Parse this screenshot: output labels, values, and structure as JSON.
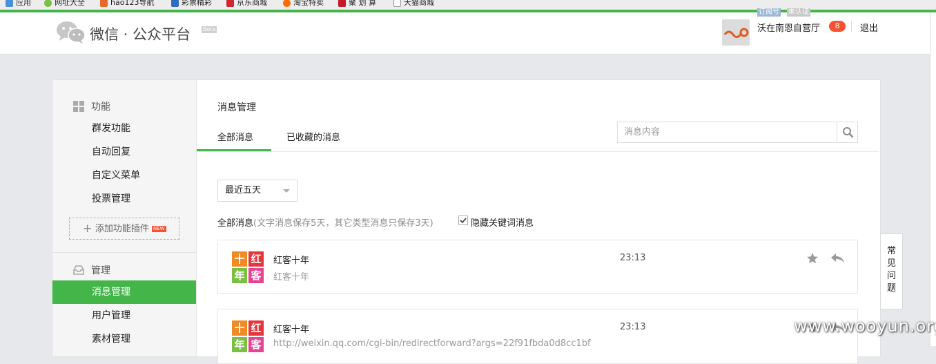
{
  "browser": {
    "bookmarks": [
      {
        "label": "应用",
        "icon": "apps-icon",
        "color": "#4a90d9"
      },
      {
        "label": "网址大全",
        "icon": "web-directory-icon",
        "color": "#7ac043"
      },
      {
        "label": "hao123导航",
        "icon": "hao123-icon",
        "color": "#e9672a"
      },
      {
        "label": "彩票精彩",
        "icon": "lottery-icon",
        "color": "#2f6dc2"
      },
      {
        "label": "京东商城",
        "icon": "jd-icon",
        "color": "#d0242f"
      },
      {
        "label": "淘宝特卖",
        "icon": "taobao-icon",
        "color": "#ff6a00"
      },
      {
        "label": "聚 划 算",
        "icon": "juhuasuan-icon",
        "color": "#c6172b"
      },
      {
        "label": "天猫商城",
        "icon": "tmall-icon",
        "color": "#ffffff"
      }
    ]
  },
  "header": {
    "logo_text": "微信 · 公众平台",
    "beta_label": "Beta",
    "account": {
      "tag_type": "订阅号",
      "tag_verify": "未认证",
      "name": "沃在南恩自营厅",
      "notification_count": "8",
      "logout_label": "退出"
    }
  },
  "sidebar": {
    "sections": [
      {
        "title": "功能",
        "icon": "grid-icon",
        "items": [
          {
            "label": "群发功能"
          },
          {
            "label": "自动回复"
          },
          {
            "label": "自定义菜单"
          },
          {
            "label": "投票管理"
          }
        ]
      },
      {
        "title": "管理",
        "icon": "inbox-icon",
        "items": [
          {
            "label": "消息管理",
            "active": true
          },
          {
            "label": "用户管理"
          },
          {
            "label": "素材管理"
          }
        ]
      }
    ],
    "add_plugin_label": "添加功能插件",
    "add_plugin_plus": "+",
    "new_badge": "NEW"
  },
  "main": {
    "title": "消息管理",
    "tabs": [
      {
        "label": "全部消息",
        "active": true
      },
      {
        "label": "已收藏的消息"
      }
    ],
    "search": {
      "placeholder": "消息内容",
      "value": ""
    },
    "filter": {
      "selected": "最近五天"
    },
    "summary": {
      "label": "全部消息",
      "note": "(文字消息保存5天，其它类型消息只保存3天)"
    },
    "hide_keyword": {
      "label": "隐藏关键词消息",
      "checked": true
    },
    "messages": [
      {
        "sender": "红客十年",
        "content": "红客十年",
        "time": "23:13"
      },
      {
        "sender": "红客十年",
        "content": "http://weixin.qq.com/cgi-bin/redirectforward?args=22f91fbda0d8cc1bf",
        "time": "23:13"
      }
    ],
    "avatar_glyphs": [
      "十",
      "红",
      "年",
      "客"
    ],
    "avatar_colors": [
      "#f08a24",
      "#e5363a",
      "#7ac143",
      "#e84393"
    ]
  },
  "faq_label": "常见问题",
  "faq_chars": [
    "常",
    "见",
    "问",
    "题"
  ],
  "watermark": "www.wooyun.org",
  "colors": {
    "accent": "#44b549",
    "badge": "#f5522f"
  }
}
